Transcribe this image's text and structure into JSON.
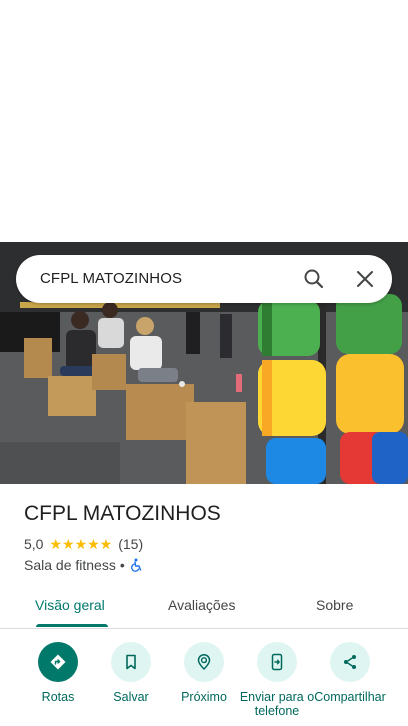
{
  "search": {
    "query": "CFPL MATOZINHOS",
    "search_icon": "search-icon",
    "close_icon": "close-icon"
  },
  "place": {
    "name": "CFPL MATOZINHOS",
    "rating": "5,0",
    "stars": "★★★★★",
    "review_count": "(15)",
    "category": "Sala de fitness",
    "separator": "•",
    "accessibility_icon": "wheelchair-icon"
  },
  "tabs": [
    {
      "label": "Visão geral",
      "active": true
    },
    {
      "label": "Avaliações",
      "active": false
    },
    {
      "label": "Sobre",
      "active": false
    }
  ],
  "actions": [
    {
      "label": "Rotas",
      "icon": "directions-icon"
    },
    {
      "label": "Salvar",
      "icon": "bookmark-icon"
    },
    {
      "label": "Próximo",
      "icon": "nearby-icon"
    },
    {
      "label": "Enviar para o telefone",
      "icon": "send-to-phone-icon"
    },
    {
      "label": "Compartilhar",
      "icon": "share-icon"
    }
  ],
  "colors": {
    "accent": "#00796b",
    "action_bg": "#dff5f2",
    "star": "#fbbc04",
    "text_primary": "#1f1f1f",
    "text_secondary": "#444746"
  }
}
